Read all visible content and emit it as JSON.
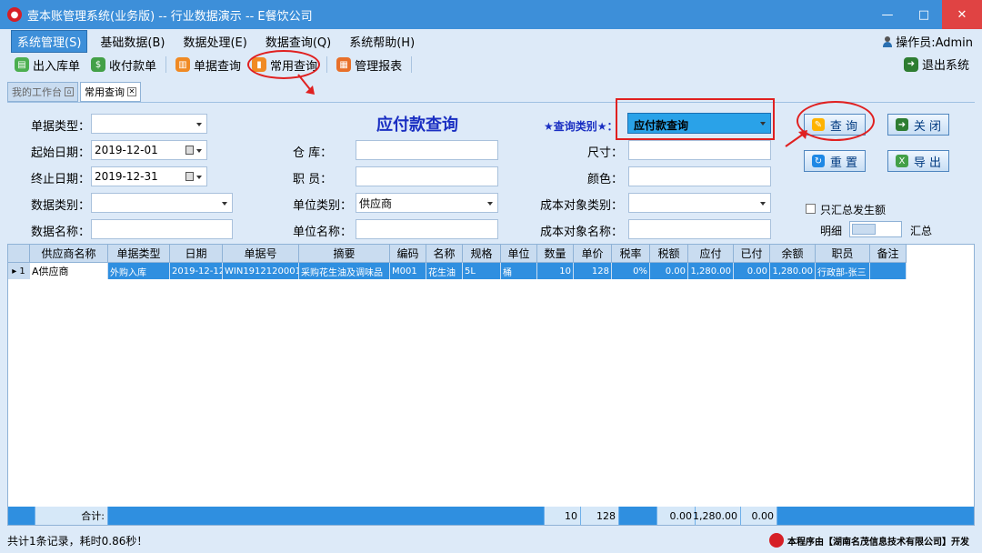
{
  "window": {
    "title": "壹本账管理系统(业务版) -- 行业数据演示 -- E餐饮公司",
    "minimize": "—",
    "maximize": "□",
    "close": "✕"
  },
  "menu": [
    "系统管理(S)",
    "基础数据(B)",
    "数据处理(E)",
    "数据查询(Q)",
    "系统帮助(H)"
  ],
  "operator": "操作员:Admin",
  "toolbar": [
    "出入库单",
    "收付款单",
    "单据查询",
    "常用查询",
    "管理报表"
  ],
  "exit": "退出系统",
  "tabs": [
    "我的工作台",
    "常用查询"
  ],
  "form": {
    "title": "应付款查询",
    "doc_type_label": "单据类型：",
    "doc_type_value": "",
    "start_date_label": "起始日期：",
    "start_date": "2019-12-01",
    "end_date_label": "终止日期：",
    "end_date": "2019-12-31",
    "data_type_label": "数据类别：",
    "data_type_value": "",
    "data_name_label": "数据名称：",
    "data_name_value": "",
    "warehouse_label": "仓      库：",
    "warehouse_value": "",
    "staff_label": "职      员：",
    "staff_value": "",
    "unit_type_label": "单位类别：",
    "unit_type_value": "供应商",
    "unit_name_label": "单位名称：",
    "unit_name_value": "",
    "query_cat_label": "★查询类别★：",
    "query_cat_value": "应付款查询",
    "size_label": "尺寸：",
    "size_value": "",
    "color_label": "颜色：",
    "color_value": "",
    "cost_type_label": "成本对象类别：",
    "cost_type_value": "",
    "cost_name_label": "成本对象名称：",
    "cost_name_value": "",
    "summary_only_label": "只汇总发生额",
    "detail_label": "明细",
    "summary_label": "汇总",
    "query_btn": "查 询",
    "close_btn": "关 闭",
    "reset_btn": "重 置",
    "export_btn": "导 出"
  },
  "grid": {
    "columns": [
      "供应商名称",
      "单据类型",
      "日期",
      "单据号",
      "摘要",
      "编码",
      "名称",
      "规格",
      "单位",
      "数量",
      "单价",
      "税率",
      "税额",
      "应付",
      "已付",
      "余额",
      "职员",
      "备注"
    ],
    "rows": [
      {
        "row_no": "▸ 1",
        "cells": [
          "A供应商",
          "外购入库",
          "2019-12-12",
          "WIN1912120001",
          "采购花生油及调味品",
          "M001",
          "花生油",
          "5L",
          "桶",
          "10",
          "128",
          "0%",
          "0.00",
          "1,280.00",
          "0.00",
          "1,280.00",
          "行政部-张三",
          ""
        ]
      }
    ],
    "footer": {
      "label": "合计:",
      "qty": "10",
      "price": "128",
      "tax": "0.00",
      "payable": "1,280.00",
      "paid": "0.00"
    }
  },
  "status": "共计1条记录，耗时0.86秒！",
  "vendor": "本程序由【湖南名茂信息技术有限公司】开发",
  "colors": {
    "titlebar": "#3d8fd9",
    "selection": "#2f8fe0",
    "highlight_red": "#e02020",
    "title_blue": "#1a2fc2"
  }
}
